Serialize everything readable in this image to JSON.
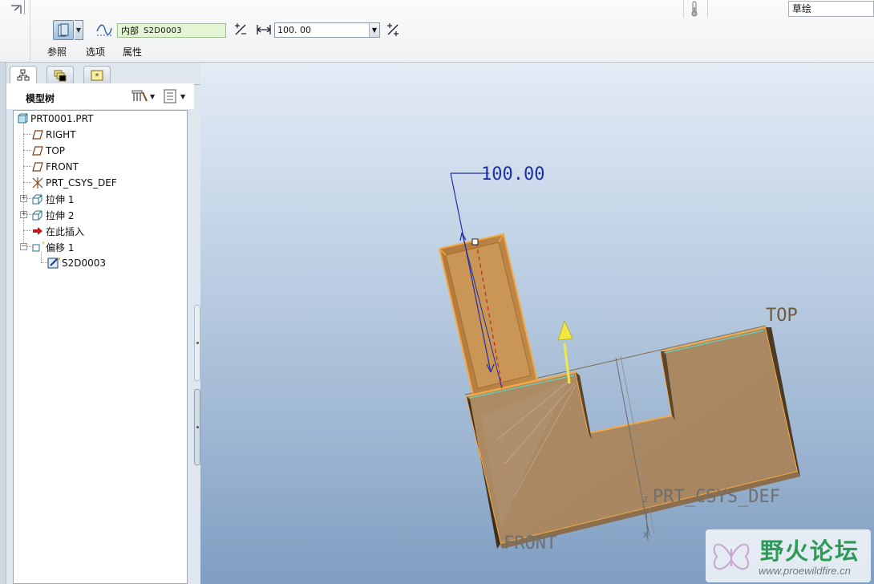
{
  "dashboard": {
    "sketch_field": {
      "prefix": "内部",
      "value": "S2D0003"
    },
    "depth_field": {
      "value": "100. 00"
    },
    "tabs": [
      {
        "label": "参照"
      },
      {
        "label": "选项"
      },
      {
        "label": "属性"
      }
    ],
    "mode_field": {
      "value": "草绘"
    }
  },
  "panel": {
    "title": "模型树"
  },
  "tree": [
    {
      "label": "PRT0001.PRT",
      "icon": "part-icon"
    },
    {
      "label": "RIGHT",
      "icon": "datum-plane-icon"
    },
    {
      "label": "TOP",
      "icon": "datum-plane-icon"
    },
    {
      "label": "FRONT",
      "icon": "datum-plane-icon"
    },
    {
      "label": "PRT_CSYS_DEF",
      "icon": "csys-icon"
    },
    {
      "label": "拉伸 1",
      "icon": "extrude-icon"
    },
    {
      "label": "拉伸 2",
      "icon": "extrude-icon"
    },
    {
      "label": "在此插入",
      "icon": "insert-here-arrow-icon"
    },
    {
      "label": "偏移 1",
      "icon": "offset-feature-icon"
    },
    {
      "label": "S2D0003",
      "icon": "sketch-icon"
    }
  ],
  "viewport": {
    "dimension_label": "100.00",
    "datum_labels": {
      "top": "TOP",
      "front": "FRONT",
      "csys": "PRT_CSYS_DEF"
    }
  },
  "watermark": {
    "title": "野火论坛",
    "url": "www.proewildfire.cn"
  },
  "colors": {
    "sketch_field_bg": "#e3f5d3",
    "part_surface": "#b08a5e",
    "highlight_edge": "#f3a945",
    "dimension_blue": "#1f2fa6",
    "viewport_top": "#e3ecf5",
    "viewport_bottom": "#7f9ec2",
    "watermark_green": "#2d9b58"
  }
}
